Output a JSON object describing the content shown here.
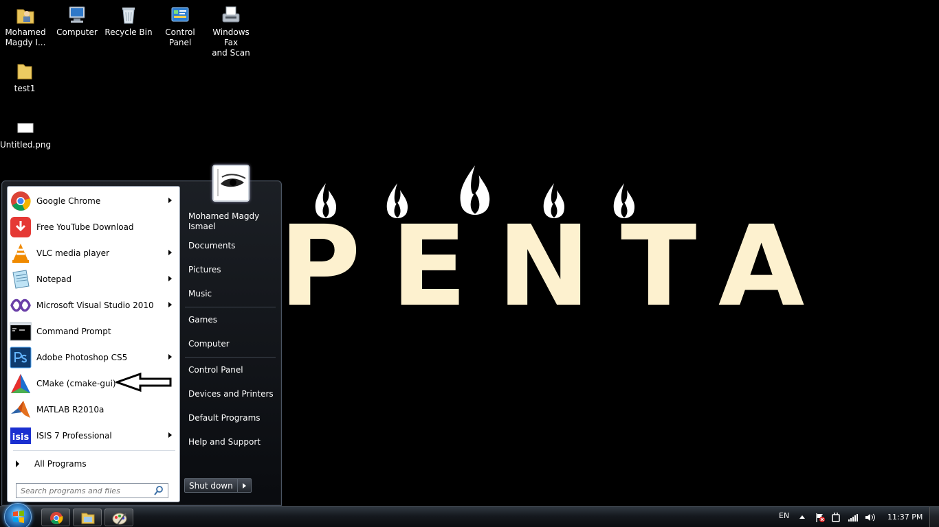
{
  "desktop": {
    "icons": [
      {
        "label": "Mohamed\nMagdy I...",
        "icon": "user-folder-icon"
      },
      {
        "label": "Computer",
        "icon": "computer-icon"
      },
      {
        "label": "Recycle Bin",
        "icon": "recycle-bin-icon"
      },
      {
        "label": "Control\nPanel",
        "icon": "control-panel-icon"
      },
      {
        "label": "Windows Fax\nand Scan",
        "icon": "fax-scan-icon"
      },
      {
        "label": "test1",
        "icon": "folder-icon"
      },
      {
        "label": "Untitled.png",
        "icon": "image-file-icon"
      }
    ],
    "wallpaper_text": "PENTA",
    "wallpaper_color": "#fdf1cf"
  },
  "start_menu": {
    "programs": [
      {
        "label": "Google Chrome",
        "icon": "chrome-icon",
        "has_submenu": true
      },
      {
        "label": "Free YouTube Download",
        "icon": "youtube-download-icon",
        "has_submenu": false
      },
      {
        "label": "VLC media player",
        "icon": "vlc-icon",
        "has_submenu": true
      },
      {
        "label": "Notepad",
        "icon": "notepad-icon",
        "has_submenu": true
      },
      {
        "label": "Microsoft Visual Studio 2010",
        "icon": "visual-studio-icon",
        "has_submenu": true
      },
      {
        "label": "Command Prompt",
        "icon": "command-prompt-icon",
        "has_submenu": false
      },
      {
        "label": "Adobe Photoshop CS5",
        "icon": "photoshop-icon",
        "has_submenu": true
      },
      {
        "label": "CMake (cmake-gui)",
        "icon": "cmake-icon",
        "has_submenu": false
      },
      {
        "label": "MATLAB R2010a",
        "icon": "matlab-icon",
        "has_submenu": false
      },
      {
        "label": "ISIS 7 Professional",
        "icon": "isis-icon",
        "has_submenu": true
      }
    ],
    "all_programs": "All Programs",
    "search_placeholder": "Search programs and files",
    "user_name": "Mohamed Magdy\nIsmael",
    "right_items": {
      "documents": "Documents",
      "pictures": "Pictures",
      "music": "Music",
      "games": "Games",
      "computer": "Computer",
      "control_panel": "Control Panel",
      "devices_printers": "Devices and Printers",
      "default_programs": "Default Programs",
      "help_support": "Help and Support"
    },
    "shutdown_label": "Shut down"
  },
  "taskbar": {
    "pinned": [
      "chrome-icon",
      "explorer-icon",
      "paint-icon"
    ],
    "language": "EN",
    "clock": "11:37 PM"
  }
}
